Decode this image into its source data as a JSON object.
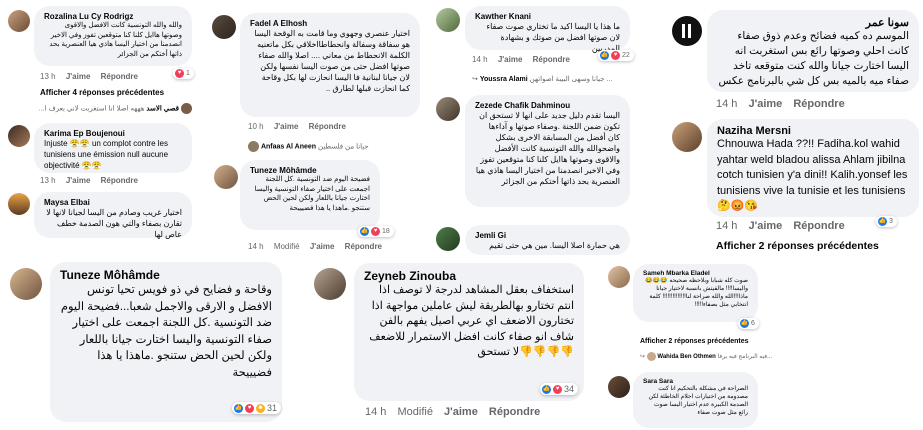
{
  "panels": {
    "p1": {
      "c1": {
        "author": "Rozalina Lu Cy Rodrigz",
        "text": "والله والله التونسية كانت الافضل والاقوى وصوتها هاايل كلنا كنا متوقعين تفوز وفي الاخير انصدمنا من اختيار اليسا هاذي هيا العنصرية بحد ذاتها أختكم من الجزائر",
        "time": "13 h",
        "like": "J'aime",
        "reply": "Répondre",
        "count": "1"
      },
      "more1": "Afficher 4 réponses précédentes",
      "reply1": {
        "author": "قصي الاسد",
        "text": "هههه اصلا انا استغربت لاني بعرف ا..."
      },
      "c2": {
        "author": "Karima Ep Boujenoui",
        "text": "Injuste 😤😤 un complot contre les tunisiens une émission null aucune objectivité 😤😤",
        "time": "13 h",
        "like": "J'aime",
        "reply": "Répondre"
      },
      "c3": {
        "author": "Maysa Elbai",
        "text": "اختيار غريب وصادم من اليسا لجيانا لانها لا تقارن بصفاء والتي هون الصدمة خطف عاص لها",
        "time": "",
        "like": "",
        "reply": ""
      }
    },
    "p2": {
      "c1": {
        "author": "Fadel A Elhosh",
        "text": "اختيار عنصري وجهوي وما قامت به الوقحة اليسا هو سفاقة وسفالة وانحطاطااخلاقي بكل ماتعنيه الكلمة الانحطاط من معاني .... اصلا والله صفاء صوتها افضل حتى من صوت اليسا نفسها ولكن لان جيانا لبنانية فا اليسا انحازت لها بكل وقاحة كما انحازت قبلها لطارق ..",
        "time": "10 h",
        "like": "J'aime",
        "reply": "Répondre"
      },
      "reply1": {
        "author": "Anfaas Al Aneen",
        "text": "جيانا من فلسطين"
      },
      "c2": {
        "author": "Tuneze Môhâmde",
        "text": "فضيحة اليوم ضد التونسية .كل اللجنة اجمعت على اختيار صفاء التونسية واليسا اختارت جيانا باللعار ولكن لحين الحض ستنجو .ماهذا يا هذا فضيييحة",
        "time": "14 h",
        "modified": "Modifié",
        "like": "J'aime",
        "reply": "Répondre",
        "count": "18"
      }
    },
    "p3": {
      "c1": {
        "author": "Kawther Knani",
        "text": "ما هذا يا اليسا اكيد ما تختاري صوت صفاء لان صوتها افضل من صوتك و بشهادة المدربين",
        "time": "14 h",
        "like": "J'aime",
        "reply": "Répondre",
        "count": "22"
      },
      "reply1": {
        "author": "Youssra Alami",
        "text": "جيانا وسهى البيبة اصواتهن ..."
      },
      "c2": {
        "author": "Zezede Chafik Dahminou",
        "text": "اليسا تقدم دليل جديد على انها لا تستحق ان تكون ضمن اللجنة .وصفاء صوتها و آداءها كان أفضل من المسابقة الاخرى بشكل واضحوالله والله التونسية كانت الأفضل والاقوى وصوتها هاايل كلنا كنا متوقعين تفوز وفي الاخير انصدمنا من اختيار اليسا هاذي هيا العنصرية بحد ذاتها أختكم من الجزائر",
        "time": "",
        "like": "",
        "reply": ""
      },
      "c3": {
        "author": "Jemli Gi",
        "text": "هي حمارة اصلا اليسا. مين هي حتى تقيم"
      }
    },
    "p4": {
      "c1": {
        "author": "سونا عمر",
        "text": "الموسم ده كميه فضائح وعدم ذوق صفاء كانت احلي وصوتها رائع بس استغربت انه اليسا اختارت جيانا والله كنت متوقعه تاخد صفاء ميه بالميه بس كل شي بالبرنامج عكس",
        "time": "14 h",
        "like": "J'aime",
        "reply": "Répondre"
      },
      "c2": {
        "author": "Naziha Mersni",
        "text": "Chnouwa Hada ??!! Fadiha.kol wahid yahtar weld bladou alissa Ahlam jibilna cotch tunisien y'a dini!! Kalih.yonsef les tunisiens vive la tunisie et les tunisiens 🤔😡😘",
        "time": "14 h",
        "like": "J'aime",
        "reply": "Répondre",
        "count": "3"
      },
      "more1": "Afficher 2 réponses précédentes"
    },
    "p5": {
      "c1": {
        "author": "Tuneze Môhâmde",
        "text": "وقاحة و فضايح في ذو فويس تحيا تونس الافضل و الارقى والاجمل شعبا...فضيحة اليوم ضد التونسية .كل اللجنة اجمعت على اختيار صفاء التونسية واليسا اختارت جيانا باللعار ولكن لحين الحض ستنجو .ماهذا يا هذا فضيييحة",
        "count": "31"
      }
    },
    "p6": {
      "c1": {
        "author": "Zeyneb Zinouba",
        "text": "استخفاف بعقل المشاهد لدرجة لا توصف اذا انتم تختارو بهالطريقة ليش عاملين مواجهة اذا تختارون الاضعف اي عربي اصيل يفهم بالفن شاف انو صفاء كانت افضل الاستمرار للاضعف 👎👎👎👎لا تستحق",
        "time": "14 h",
        "modified": "Modifié",
        "like": "J'aime",
        "reply": "Répondre",
        "count": "34"
      }
    },
    "p7": {
      "c1": {
        "author": "Sameh Mbarka Eladel",
        "text": "صوت كله شبابا وبلاحظه صحيحه 😂😂😂 واليسا!!!! مالقيتش بانسبة لاختيار جيانا ماذا!!!الله والله صراحة لنا!!!!!!!!!!!!!! كلمة انتخابي مثل بصفاء!!!!!",
        "count": "6"
      },
      "more1": "Afficher 2 réponses précédentes",
      "reply1": {
        "author": "Wahida Ben Othmen",
        "text": "فيه البرنامج فيه يرفا..."
      },
      "c2": {
        "author": "Sara Sara",
        "text": "الصراحة في مشكلة بالتحكيم انا كنت مصدومة من اختيارات احلام الخاطئة لكن الصدمة الكبيرة عدم اختيار اليسا صوت رائع مثل صوت صفاء"
      }
    }
  },
  "reactions": {
    "like": "👍",
    "love": "❤",
    "haha": "😆"
  }
}
